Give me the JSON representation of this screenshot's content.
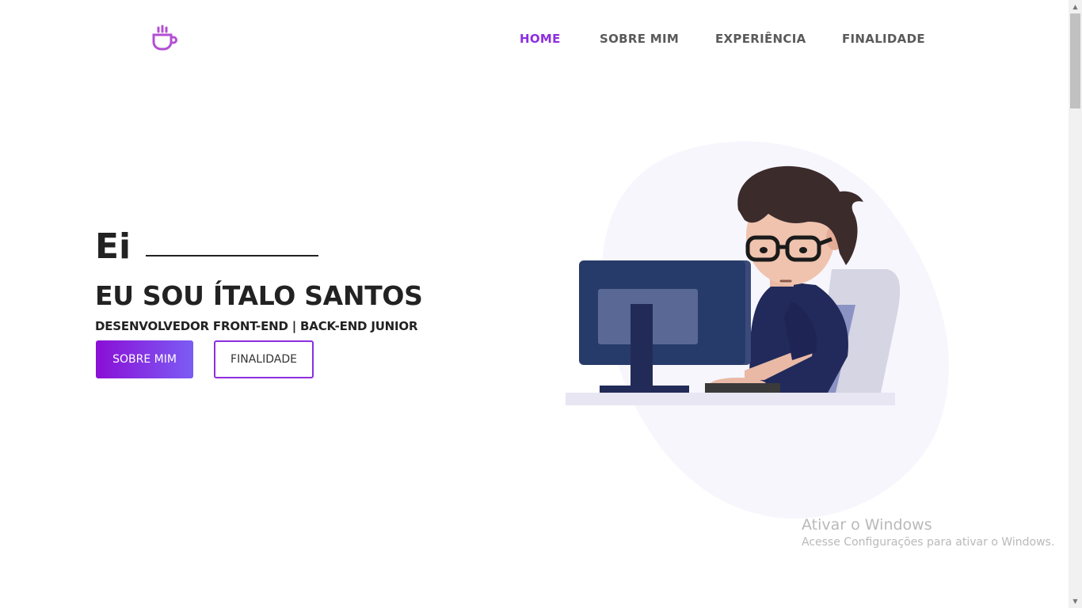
{
  "nav": {
    "logo_icon": "coffee-cup-icon",
    "items": [
      {
        "label": "HOME",
        "active": true
      },
      {
        "label": "SOBRE MIM",
        "active": false
      },
      {
        "label": "EXPERIÊNCIA",
        "active": false
      },
      {
        "label": "FINALIDADE",
        "active": false
      }
    ]
  },
  "hero": {
    "greeting": "Ei",
    "name": "EU SOU ÍTALO SANTOS",
    "subtitle": "DESENVOLVEDOR FRONT-END | BACK-END JUNIOR",
    "primary_button": "SOBRE MIM",
    "secondary_button": "FINALIDADE",
    "illustration_icon": "developer-at-computer-illustration"
  },
  "watermark": {
    "title": "Ativar o Windows",
    "subtitle": "Acesse Configurações para ativar o Windows."
  },
  "colors": {
    "accent": "#8d2ee0",
    "gradient_start": "#8a0fd6",
    "gradient_end": "#7c5cf4",
    "text": "#222222",
    "nav_text": "#5a5a5a"
  }
}
